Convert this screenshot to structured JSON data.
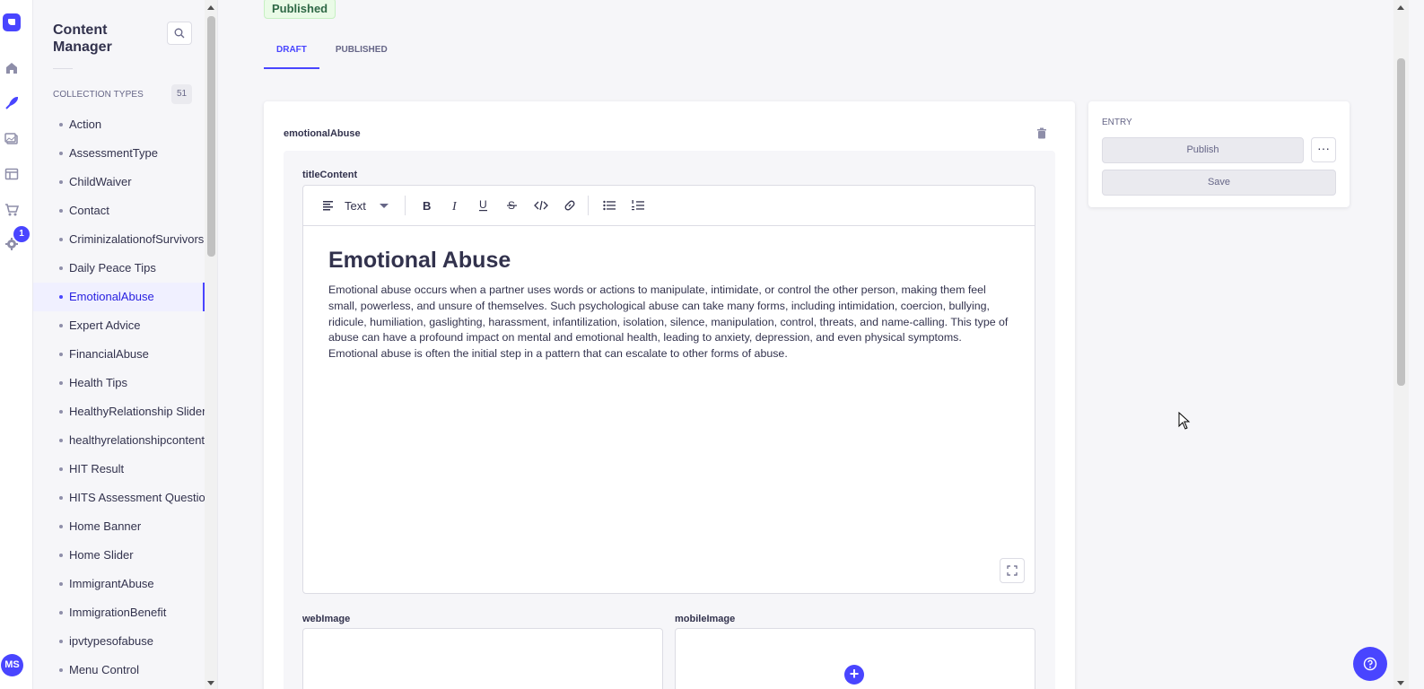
{
  "rail": {
    "notification_count": "1",
    "avatar_initials": "MS",
    "icons": [
      "logo-icon",
      "home-icon",
      "content-manager-icon",
      "media-library-icon",
      "content-type-builder-icon",
      "marketplace-icon",
      "settings-icon"
    ]
  },
  "sidebar": {
    "title": "Content Manager",
    "section_label": "COLLECTION TYPES",
    "section_count": "51",
    "items": [
      {
        "label": "Action"
      },
      {
        "label": "AssessmentType"
      },
      {
        "label": "ChildWaiver"
      },
      {
        "label": "Contact"
      },
      {
        "label": "CriminizalationofSurvivors"
      },
      {
        "label": "Daily Peace Tips"
      },
      {
        "label": "EmotionalAbuse"
      },
      {
        "label": "Expert Advice"
      },
      {
        "label": "FinancialAbuse"
      },
      {
        "label": "Health Tips"
      },
      {
        "label": "HealthyRelationship Slider"
      },
      {
        "label": "healthyrelationshipcontent"
      },
      {
        "label": "HIT Result"
      },
      {
        "label": "HITS Assessment Question"
      },
      {
        "label": "Home Banner"
      },
      {
        "label": "Home Slider"
      },
      {
        "label": "ImmigrantAbuse"
      },
      {
        "label": "ImmigrationBenefit"
      },
      {
        "label": "ipvtypesofabuse"
      },
      {
        "label": "Menu Control"
      }
    ],
    "active_index": 6
  },
  "main": {
    "status_badge": "Published",
    "tabs": [
      {
        "label": "DRAFT"
      },
      {
        "label": "PUBLISHED"
      }
    ],
    "component_label": "emotionalAbuse",
    "title_field_label": "titleContent",
    "toolbar": {
      "block_type": "Text"
    },
    "content": {
      "heading": "Emotional Abuse",
      "paragraph": "Emotional abuse occurs when a partner uses words or actions to manipulate, intimidate, or control the other person, making them feel small, powerless, and unsure of themselves. Such psychological abuse can take many forms, including intimidation, coercion, bullying, ridicule, humiliation, gaslighting, harassment, infantilization, isolation, silence, manipulation, control, threats, and name-calling. This type of abuse can have a profound impact on mental and emotional health, leading to anxiety, depression, and even physical symptoms. Emotional abuse is often the initial step in a pattern that can escalate to other forms of abuse."
    },
    "web_image_label": "webImage",
    "mobile_image_label": "mobileImage"
  },
  "entry": {
    "title": "ENTRY",
    "publish_label": "Publish",
    "save_label": "Save",
    "more_label": "···"
  },
  "colors": {
    "accent": "#4945ff",
    "published_bg": "#eafbe7",
    "published_text": "#2f6846"
  }
}
